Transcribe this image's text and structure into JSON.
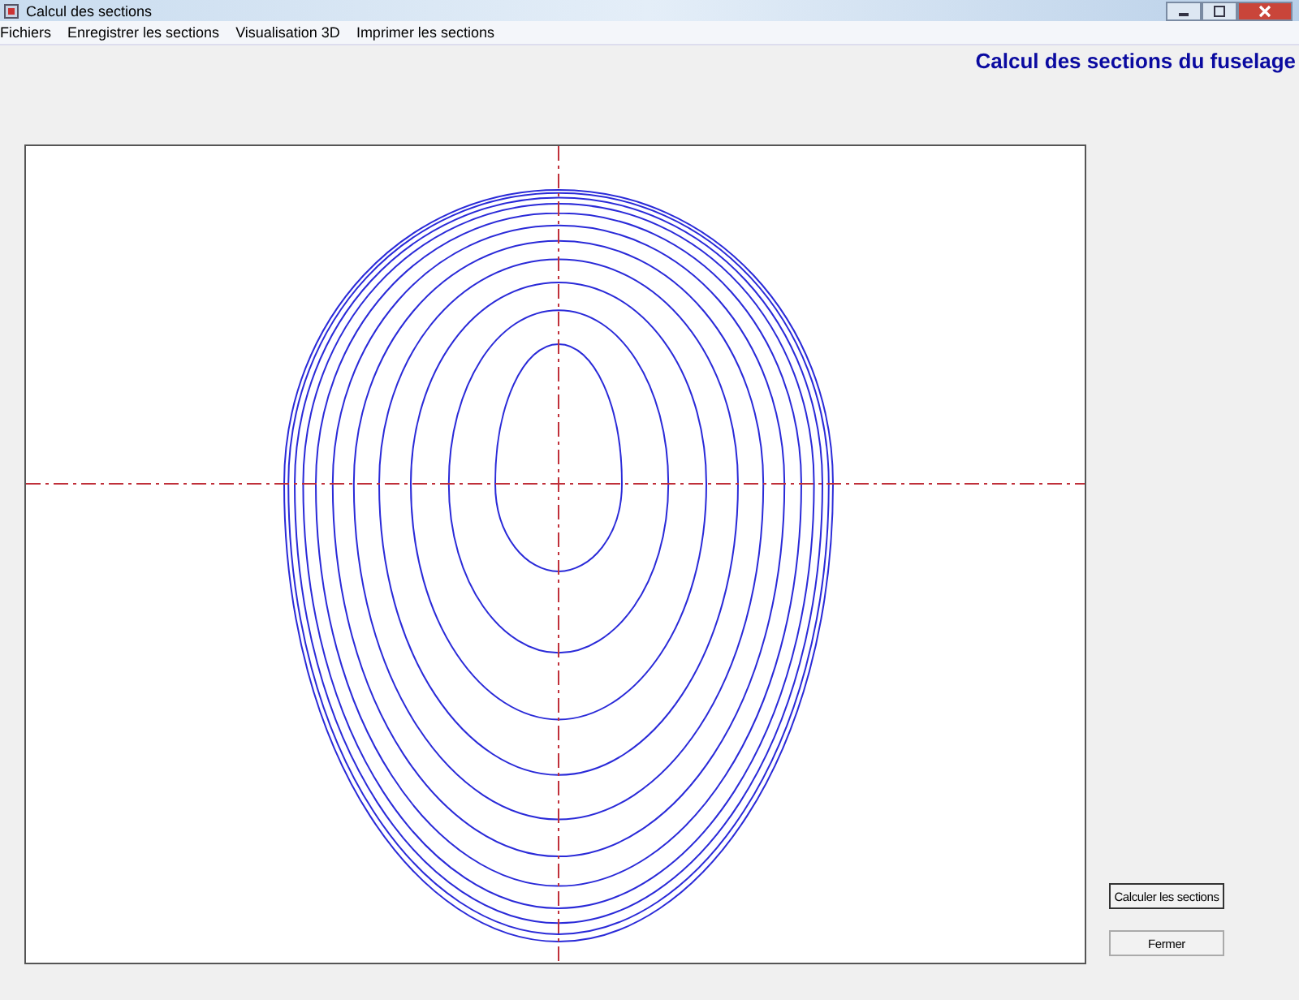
{
  "window": {
    "title": "Calcul des sections"
  },
  "menu": [
    "Fichiers",
    "Enregistrer les sections",
    "Visualisation 3D",
    "Imprimer les sections"
  ],
  "heading": "Calcul des sections du fuselage",
  "buttons": [
    "Calculer les sections",
    "Fermer"
  ]
}
